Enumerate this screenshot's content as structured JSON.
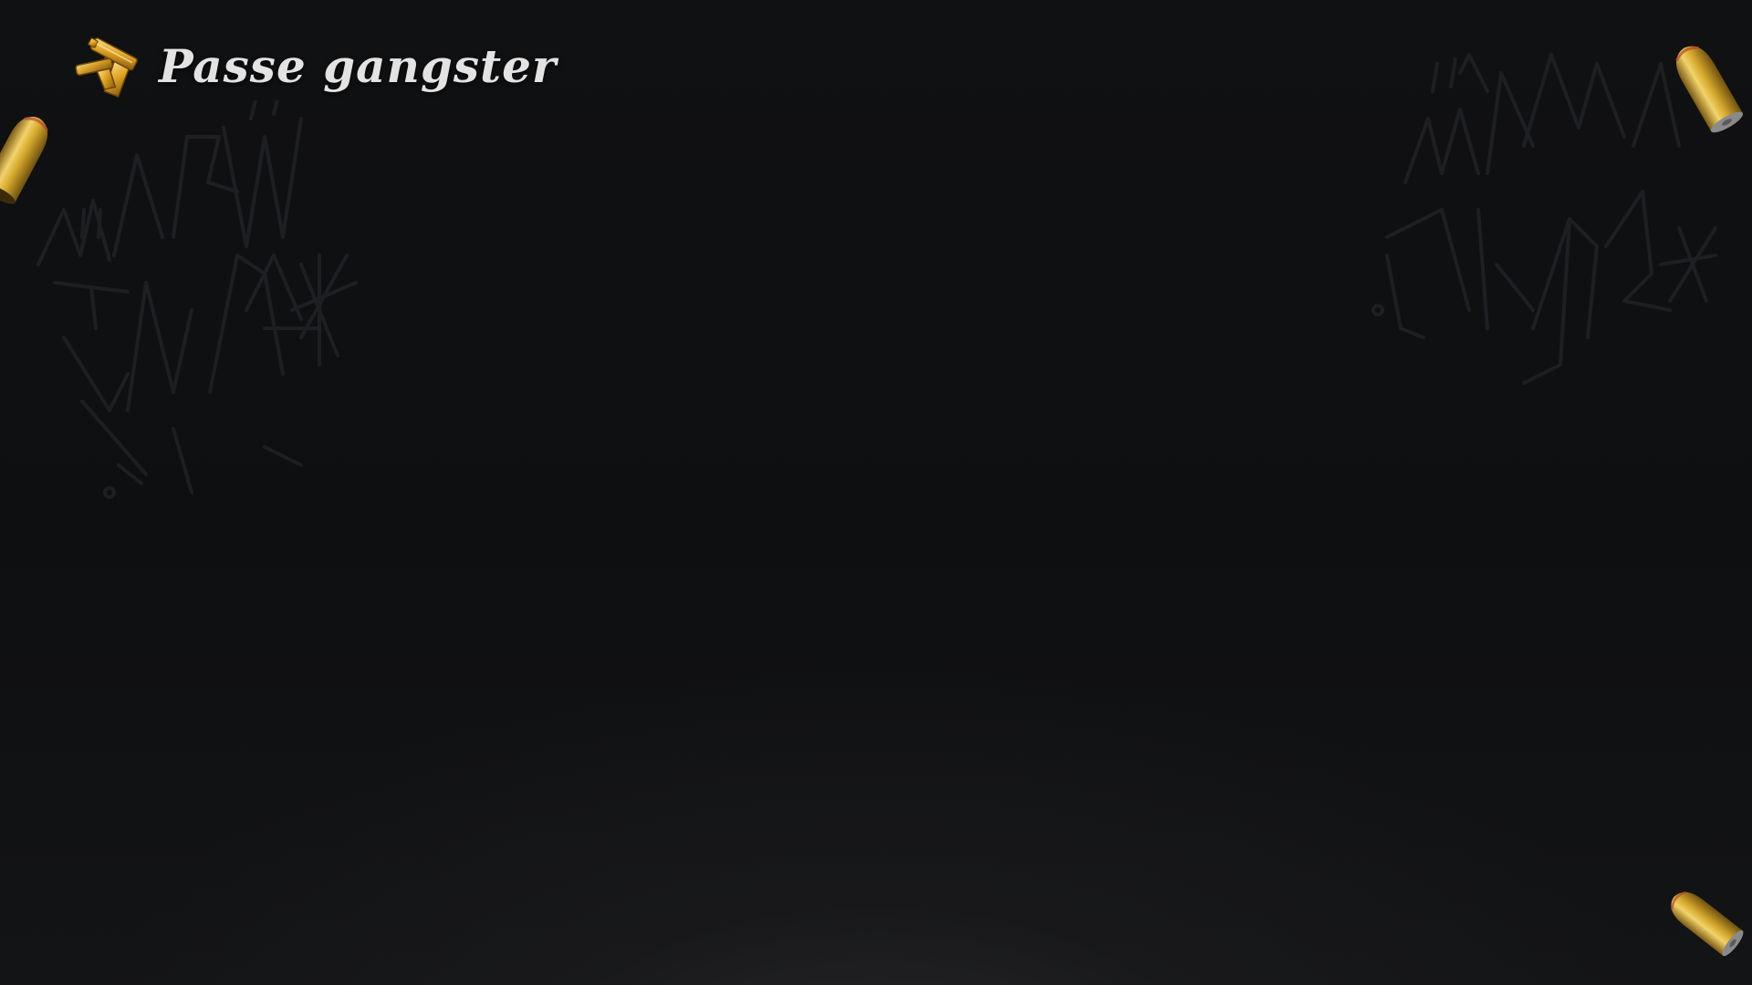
{
  "header": {
    "title": "Passe gangster",
    "icon": "pistol-icon"
  },
  "decorations": {
    "graffiti": [
      "graffiti-tag-left",
      "graffiti-tag-right"
    ],
    "bullets": [
      "bullet-icon",
      "bullet-icon",
      "bullet-icon"
    ]
  },
  "colors": {
    "background": "#0f1012",
    "title_text": "#e3e3e3",
    "gold": "#d9a628",
    "graffiti_stroke": "#25272b"
  }
}
